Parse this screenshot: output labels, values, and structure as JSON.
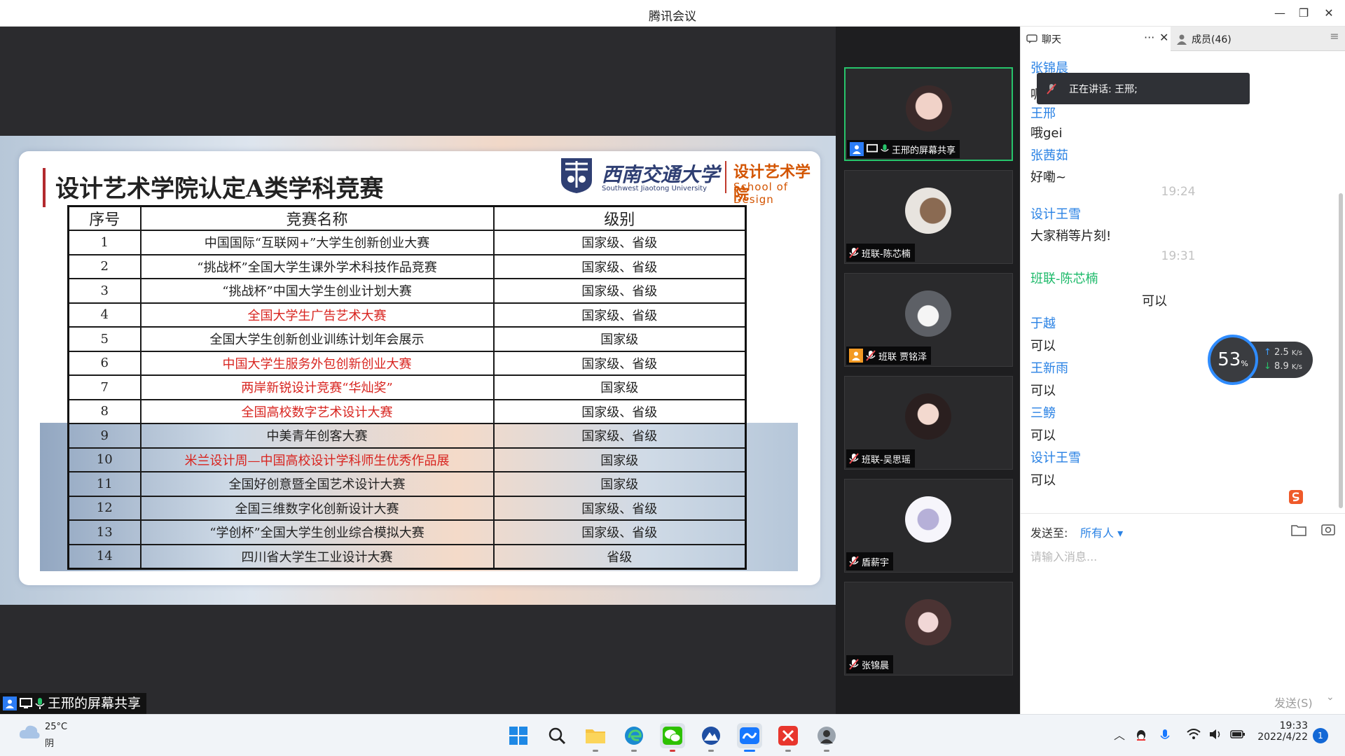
{
  "window": {
    "title": "腾讯会议",
    "minimize_glyph": "—",
    "restore_glyph": "❐",
    "close_glyph": "✕"
  },
  "slide": {
    "title": "设计艺术学院认定A类学科竞赛",
    "logo_university": "西南交通大学",
    "logo_university_en": "Southwest Jiaotong University",
    "logo_school": "设计艺术学院",
    "logo_school_en": "School of Design",
    "table": {
      "headers": [
        "序号",
        "竞赛名称",
        "级别"
      ],
      "rows": [
        {
          "idx": "1",
          "name": "中国国际“互联网+”大学生创新创业大赛",
          "level": "国家级、省级",
          "red": false
        },
        {
          "idx": "2",
          "name": "“挑战杯”全国大学生课外学术科技作品竞赛",
          "level": "国家级、省级",
          "red": false
        },
        {
          "idx": "3",
          "name": "“挑战杯”中国大学生创业计划大赛",
          "level": "国家级、省级",
          "red": false
        },
        {
          "idx": "4",
          "name": "全国大学生广告艺术大赛",
          "level": "国家级、省级",
          "red": true
        },
        {
          "idx": "5",
          "name": "全国大学生创新创业训练计划年会展示",
          "level": "国家级",
          "red": false
        },
        {
          "idx": "6",
          "name": "中国大学生服务外包创新创业大赛",
          "level": "国家级、省级",
          "red": true
        },
        {
          "idx": "7",
          "name": "两岸新锐设计竞赛“华灿奖”",
          "level": "国家级",
          "red": true
        },
        {
          "idx": "8",
          "name": "全国高校数字艺术设计大赛",
          "level": "国家级、省级",
          "red": true
        },
        {
          "idx": "9",
          "name": "中美青年创客大赛",
          "level": "国家级、省级",
          "red": false
        },
        {
          "idx": "10",
          "name": "米兰设计周—中国高校设计学科师生优秀作品展",
          "level": "国家级",
          "red": true
        },
        {
          "idx": "11",
          "name": "全国好创意暨全国艺术设计大赛",
          "level": "国家级",
          "red": false
        },
        {
          "idx": "12",
          "name": "全国三维数字化创新设计大赛",
          "level": "国家级、省级",
          "red": false
        },
        {
          "idx": "13",
          "name": "“学创杯”全国大学生创业综合模拟大赛",
          "level": "国家级、省级",
          "red": false
        },
        {
          "idx": "14",
          "name": "四川省大学生工业设计大赛",
          "level": "省级",
          "red": false
        }
      ]
    }
  },
  "sharer_label": "王邢的屏幕共享",
  "participants": [
    {
      "name": "王邢的屏幕共享",
      "active": true
    },
    {
      "name": "班联-陈芯楠",
      "active": false
    },
    {
      "name": "班联 贾铭泽",
      "active": false
    },
    {
      "name": "班联-吴思瑶",
      "active": false
    },
    {
      "name": "盾薪宇",
      "active": false
    },
    {
      "name": "张锦晨",
      "active": false
    }
  ],
  "chat": {
    "tab_chat": "聊天",
    "tab_members": "成员(46)",
    "tab_more": "···",
    "tab_close": "✕",
    "tab_menu": "≡",
    "messages": {
      "s1": "张锦晨",
      "b1": "呃",
      "s2": "王邢",
      "b2": "哦gei",
      "s3": "张茜茹",
      "b3": "好嘞~",
      "t1": "19:24",
      "s4": "设计王雪",
      "b4": "大家稍等片刻!",
      "t2": "19:31",
      "s5": "班联-陈芯楠",
      "b5": "可以",
      "s6": "于越",
      "b6": "可以",
      "s7": "王新雨",
      "b7": "可以",
      "s8": "三鳑",
      "b8": "可以",
      "s9": "设计王雪",
      "b9": "可以"
    },
    "speaking": "正在讲话: 王邢;",
    "send_to_label": "发送至:",
    "send_to_value": "所有人 ▾",
    "input_placeholder": "请输入消息...",
    "send_button": "发送(S)",
    "send_arrow": "⌄"
  },
  "network": {
    "percent": "53",
    "percent_unit": "%",
    "up": "2.5",
    "down": "8.9",
    "unit": "K/s"
  },
  "taskbar": {
    "temperature": "25°C",
    "condition": "阴",
    "time": "19:33",
    "date": "2022/4/22",
    "notification_count": "1"
  }
}
